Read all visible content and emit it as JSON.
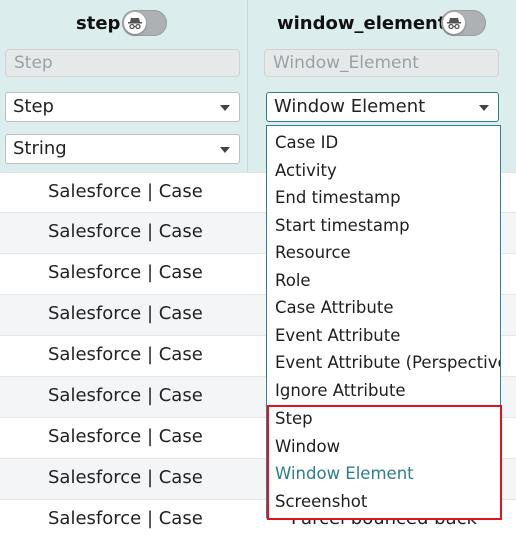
{
  "columns": [
    {
      "title": "step",
      "placeholder": "Step",
      "type_select": "Step",
      "format_select": "String"
    },
    {
      "title": "window_element",
      "placeholder": "Window_Element",
      "type_select": "Window Element"
    }
  ],
  "rows": [
    {
      "step": "Salesforce | Case"
    },
    {
      "step": "Salesforce | Case"
    },
    {
      "step": "Salesforce | Case"
    },
    {
      "step": "Salesforce | Case"
    },
    {
      "step": "Salesforce | Case"
    },
    {
      "step": "Salesforce | Case"
    },
    {
      "step": "Salesforce | Case"
    },
    {
      "step": "Salesforce | Case"
    },
    {
      "step": "Salesforce | Case",
      "window_element": "Parcel bounced back"
    }
  ],
  "dropdown": {
    "options": [
      "Case ID",
      "Activity",
      "End timestamp",
      "Start timestamp",
      "Resource",
      "Role",
      "Case Attribute",
      "Event Attribute",
      "Event Attribute (Perspective)",
      "Ignore Attribute",
      "Step",
      "Window",
      "Window Element",
      "Screenshot"
    ],
    "selected": "Window Element"
  },
  "icons": {
    "toggle": "incognito-icon",
    "caret": "chevron-down-icon"
  },
  "colors": {
    "header_bg": "#dceded",
    "selected_option": "#2a7f8d",
    "highlight_box": "#e0141c"
  }
}
